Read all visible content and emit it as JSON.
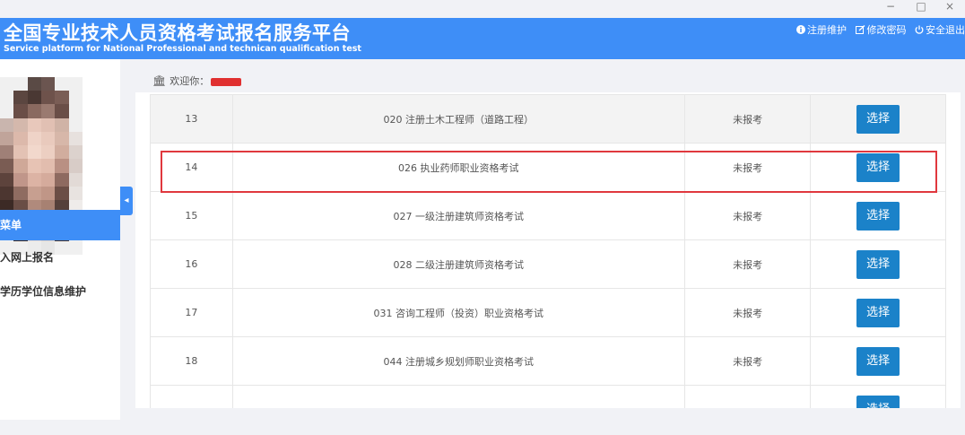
{
  "window": {
    "minimize": "−",
    "maximize": "□",
    "close": "×"
  },
  "header": {
    "title": "全国专业技术人员资格考试报名服务平台",
    "subtitle": "Service platform for National Professional and technican qualification test",
    "links": [
      {
        "icon": "info-icon",
        "label": "注册维护"
      },
      {
        "icon": "edit-icon",
        "label": "修改密码"
      },
      {
        "icon": "power-icon",
        "label": "安全退出"
      }
    ]
  },
  "sidebar": {
    "menu_header": "菜单",
    "items": [
      {
        "label": "入网上报名"
      },
      {
        "label": "学历学位信息维护"
      }
    ]
  },
  "welcome": {
    "label": "欢迎你："
  },
  "exams": {
    "action_label": "选择",
    "rows": [
      {
        "num": "13",
        "name": "020 注册土木工程师（道路工程）",
        "status": "未报考"
      },
      {
        "num": "14",
        "name": "026 执业药师职业资格考试",
        "status": "未报考"
      },
      {
        "num": "15",
        "name": "027 一级注册建筑师资格考试",
        "status": "未报考"
      },
      {
        "num": "16",
        "name": "028 二级注册建筑师资格考试",
        "status": "未报考"
      },
      {
        "num": "17",
        "name": "031 咨询工程师（投资）职业资格考试",
        "status": "未报考"
      },
      {
        "num": "18",
        "name": "044 注册城乡规划师职业资格考试",
        "status": "未报考"
      },
      {
        "num": "",
        "name": "",
        "status": ""
      }
    ]
  },
  "colors": {
    "header_blue": "#3e8ef7",
    "button_blue": "#1b82c9",
    "highlight_red": "#e0383e"
  }
}
